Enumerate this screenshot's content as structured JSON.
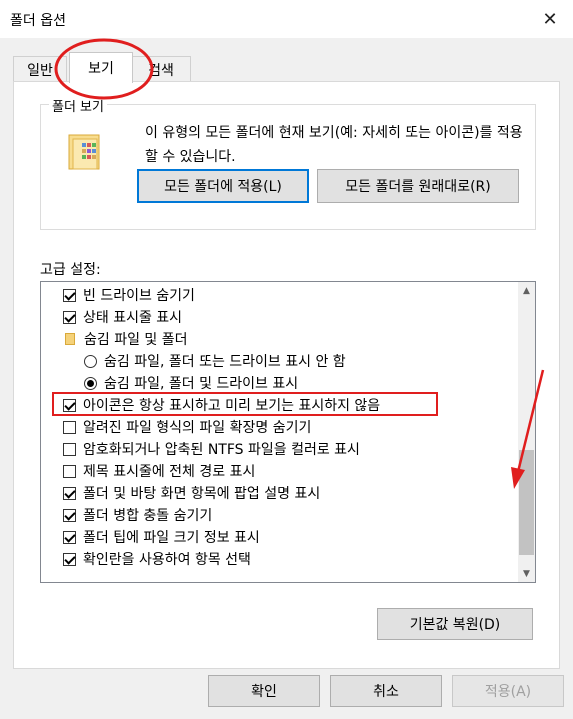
{
  "window": {
    "title": "폴더 옵션",
    "close_glyph": "✕"
  },
  "tabs": [
    {
      "label": "일반"
    },
    {
      "label": "보기"
    },
    {
      "label": "검색"
    }
  ],
  "folder_views": {
    "title": "폴더 보기",
    "description": "이 유형의 모든 폴더에 현재 보기(예: 자세히 또는 아이콘)를 적용할 수 있습니다.",
    "apply_button": "모든 폴더에 적용(L)",
    "reset_button": "모든 폴더를 원래대로(R)"
  },
  "advanced": {
    "label": "고급 설정:",
    "items": [
      {
        "type": "checkbox",
        "checked": true,
        "label": "빈 드라이브 숨기기"
      },
      {
        "type": "checkbox",
        "checked": true,
        "label": "상태 표시줄 표시"
      },
      {
        "type": "folder",
        "label": "숨김 파일 및 폴더"
      },
      {
        "type": "radio",
        "checked": false,
        "label": "숨김 파일, 폴더 또는 드라이브 표시 안 함"
      },
      {
        "type": "radio",
        "checked": true,
        "label": "숨김 파일, 폴더 및 드라이브 표시"
      },
      {
        "type": "checkbox",
        "checked": true,
        "label": "아이콘은 항상 표시하고 미리 보기는 표시하지 않음"
      },
      {
        "type": "checkbox",
        "checked": false,
        "label": "알려진 파일 형식의 파일 확장명 숨기기"
      },
      {
        "type": "checkbox",
        "checked": false,
        "label": "암호화되거나 압축된 NTFS 파일을 컬러로 표시"
      },
      {
        "type": "checkbox",
        "checked": false,
        "label": "제목 표시줄에 전체 경로 표시"
      },
      {
        "type": "checkbox",
        "checked": true,
        "label": "폴더 및 바탕 화면 항목에 팝업 설명 표시"
      },
      {
        "type": "checkbox",
        "checked": true,
        "label": "폴더 병합 충돌 숨기기"
      },
      {
        "type": "checkbox",
        "checked": true,
        "label": "폴더 팁에 파일 크기 정보 표시"
      },
      {
        "type": "checkbox",
        "checked": true,
        "label": "확인란을 사용하여 항목 선택"
      }
    ],
    "restore_button": "기본값 복원(D)"
  },
  "footer": {
    "ok": "확인",
    "cancel": "취소",
    "apply": "적용(A)"
  },
  "colors": {
    "accent": "#0078d7",
    "annotation": "#e01e1e"
  }
}
